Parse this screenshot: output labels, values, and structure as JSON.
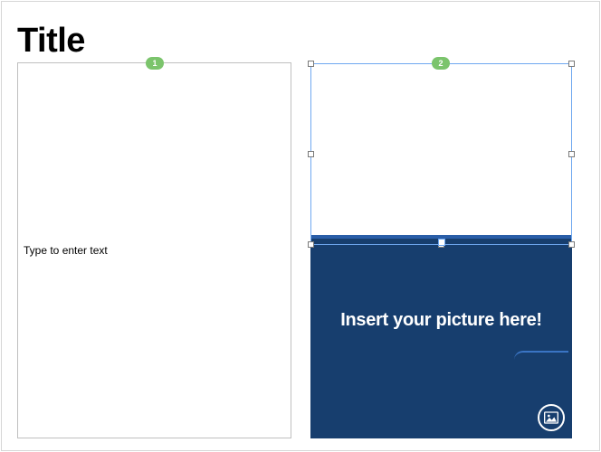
{
  "slide": {
    "title": "Title",
    "placeholders": [
      {
        "index": "1",
        "type": "text",
        "prompt": "Type to enter text"
      },
      {
        "index": "2",
        "type": "picture",
        "prompt": "Insert your picture here!",
        "selected": true
      }
    ],
    "colors": {
      "picture_bg": "#173e6e",
      "picture_border": "#2a5ea8",
      "selection": "#6fa8f0",
      "badge": "#7bc46c"
    }
  }
}
